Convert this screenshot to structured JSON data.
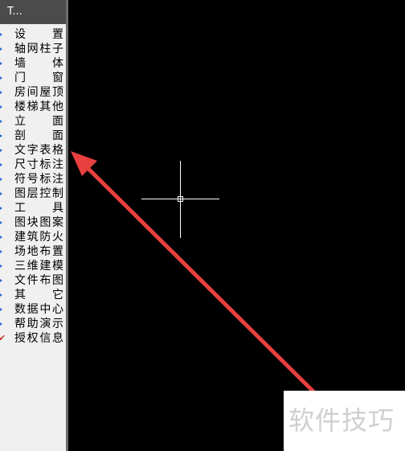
{
  "panel": {
    "title": "T...",
    "items": [
      {
        "label": "设 置",
        "marker": "bullet"
      },
      {
        "label": "轴网柱子",
        "marker": "bullet"
      },
      {
        "label": "墙 体",
        "marker": "bullet"
      },
      {
        "label": "门 窗",
        "marker": "bullet"
      },
      {
        "label": "房间屋顶",
        "marker": "bullet"
      },
      {
        "label": "楼梯其他",
        "marker": "bullet"
      },
      {
        "label": "立 面",
        "marker": "bullet"
      },
      {
        "label": "剖 面",
        "marker": "bullet"
      },
      {
        "label": "文字表格",
        "marker": "bullet"
      },
      {
        "label": "尺寸标注",
        "marker": "bullet"
      },
      {
        "label": "符号标注",
        "marker": "bullet"
      },
      {
        "label": "图层控制",
        "marker": "bullet"
      },
      {
        "label": "工 具",
        "marker": "bullet"
      },
      {
        "label": "图块图案",
        "marker": "bullet"
      },
      {
        "label": "建筑防火",
        "marker": "bullet"
      },
      {
        "label": "场地布置",
        "marker": "bullet"
      },
      {
        "label": "三维建模",
        "marker": "bullet"
      },
      {
        "label": "文件布图",
        "marker": "bullet"
      },
      {
        "label": "其 它",
        "marker": "bullet"
      },
      {
        "label": "数据中心",
        "marker": "bullet"
      },
      {
        "label": "帮助演示",
        "marker": "bullet"
      },
      {
        "label": "授权信息",
        "marker": "check"
      }
    ]
  },
  "canvas": {
    "background": "#000000",
    "crosshair_color": "#ffffff"
  },
  "annotation": {
    "arrow_color": "#e8403f"
  },
  "watermark": {
    "text": "软件技巧"
  }
}
